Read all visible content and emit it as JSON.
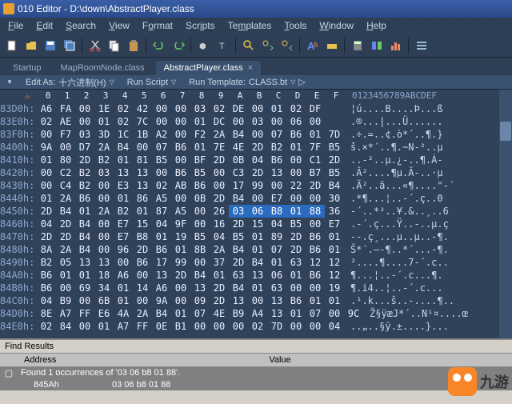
{
  "title": "010 Editor - D:\\down\\AbstractPlayer.class",
  "menu": [
    "File",
    "Edit",
    "Search",
    "View",
    "Format",
    "Scripts",
    "Templates",
    "Tools",
    "Window",
    "Help"
  ],
  "tabs": {
    "startup": "Startup",
    "map": "MapRoomNode.class",
    "active": "AbstractPlayer.class"
  },
  "sub": {
    "star": "☆",
    "editas_lbl": "Edit As:",
    "editas_val": "十六进制(H)",
    "runscript": "Run Script",
    "runtpl_lbl": "Run Template:",
    "runtpl_val": "CLASS.bt"
  },
  "hexcols": [
    "0",
    "1",
    "2",
    "3",
    "4",
    "5",
    "6",
    "7",
    "8",
    "9",
    "A",
    "B",
    "C",
    "D",
    "E",
    "F"
  ],
  "asciicol": "0123456789ABCDEF",
  "rows": [
    {
      "o": "83D0h:",
      "b": [
        "A6",
        "FA",
        "00",
        "1E",
        "02",
        "42",
        "00",
        "00",
        "03",
        "02",
        "DE",
        "00",
        "01",
        "02",
        "DF"
      ],
      "a": "¦ú....B....Þ...ß"
    },
    {
      "o": "83E0h:",
      "b": [
        "02",
        "AE",
        "00",
        "01",
        "02",
        "7C",
        "00",
        "00",
        "01",
        "DC",
        "00",
        "03",
        "00",
        "06",
        "00"
      ],
      "a": ".®...|...Ü......"
    },
    {
      "o": "83F0h:",
      "b": [
        "00",
        "F7",
        "03",
        "3D",
        "1C",
        "1B",
        "A2",
        "00",
        "F2",
        "2A",
        "B4",
        "00",
        "07",
        "B6",
        "01",
        "7D"
      ],
      "a": ".÷.=..¢.ò*´..¶.}"
    },
    {
      "o": "8400h:",
      "b": [
        "9A",
        "00",
        "D7",
        "2A",
        "B4",
        "00",
        "07",
        "B6",
        "01",
        "7E",
        "4E",
        "2D",
        "B2",
        "01",
        "7F",
        "B5"
      ],
      "a": "š.×*´..¶.~N-²..µ"
    },
    {
      "o": "8410h:",
      "b": [
        "01",
        "80",
        "2D",
        "B2",
        "01",
        "81",
        "B5",
        "00",
        "BF",
        "2D",
        "0B",
        "04",
        "B6",
        "00",
        "C1",
        "2D"
      ],
      "a": "..-²..µ.¿-..¶.Á-"
    },
    {
      "o": "8420h:",
      "b": [
        "00",
        "C2",
        "B2",
        "03",
        "13",
        "13",
        "00",
        "B6",
        "B5",
        "00",
        "C3",
        "2D",
        "13",
        "00",
        "B7",
        "B5"
      ],
      "a": ".Â²....¶µ.Ã-..·µ"
    },
    {
      "o": "8430h:",
      "b": [
        "00",
        "C4",
        "B2",
        "00",
        "E3",
        "13",
        "02",
        "AB",
        "B6",
        "00",
        "17",
        "99",
        "00",
        "22",
        "2D",
        "B4"
      ],
      "a": ".Ä²..ã...«¶....\"-´"
    },
    {
      "o": "8440h:",
      "b": [
        "01",
        "2A",
        "B6",
        "00",
        "01",
        "86",
        "A5",
        "00",
        "0B",
        "2D",
        "B4",
        "00",
        "E7",
        "00",
        "00",
        "30"
      ],
      "a": ".*¶...¦..-´.ç..0"
    },
    {
      "o": "8450h:",
      "b": [
        "2D",
        "B4",
        "01",
        "2A",
        "B2",
        "01",
        "87",
        "A5",
        "00",
        "26",
        "03",
        "06",
        "B8",
        "01",
        "88",
        "36"
      ],
      "hl": [
        10,
        11,
        12,
        13,
        14
      ],
      "a": "-´..*²..¥.&..¸..6"
    },
    {
      "o": "8460h:",
      "b": [
        "04",
        "2D",
        "B4",
        "00",
        "E7",
        "15",
        "04",
        "9F",
        "00",
        "16",
        "2D",
        "15",
        "04",
        "B5",
        "00",
        "E7"
      ],
      "a": ".-´.ç...Ÿ..-..µ.ç"
    },
    {
      "o": "8470h:",
      "b": [
        "2D",
        "2D",
        "B4",
        "00",
        "E7",
        "B8",
        "01",
        "19",
        "B5",
        "04",
        "B5",
        "01",
        "89",
        "2D",
        "B6",
        "01"
      ],
      "a": "--.ç¸...µ..µ..-¶."
    },
    {
      "o": "8480h:",
      "b": [
        "8A",
        "2A",
        "B4",
        "00",
        "96",
        "2D",
        "B6",
        "01",
        "8B",
        "2A",
        "B4",
        "01",
        "07",
        "2D",
        "B6",
        "01"
      ],
      "a": "Š*´.–-¶..*´...-¶."
    },
    {
      "o": "8490h:",
      "b": [
        "B2",
        "05",
        "13",
        "13",
        "00",
        "B6",
        "17",
        "99",
        "00",
        "37",
        "2D",
        "B4",
        "01",
        "63",
        "12",
        "12"
      ],
      "a": "²....¶....7-´.c.."
    },
    {
      "o": "84A0h:",
      "b": [
        "B6",
        "01",
        "01",
        "18",
        "A6",
        "00",
        "13",
        "2D",
        "B4",
        "01",
        "63",
        "13",
        "06",
        "01",
        "B6",
        "12"
      ],
      "a": "¶...¦..-´.c...¶."
    },
    {
      "o": "84B0h:",
      "b": [
        "B6",
        "00",
        "69",
        "34",
        "01",
        "14",
        "A6",
        "00",
        "13",
        "2D",
        "B4",
        "01",
        "63",
        "00",
        "00",
        "19"
      ],
      "a": "¶.i4..¦..-´.c..."
    },
    {
      "o": "84C0h:",
      "b": [
        "04",
        "B9",
        "00",
        "6B",
        "01",
        "00",
        "9A",
        "00",
        "09",
        "2D",
        "13",
        "00",
        "13",
        "B6",
        "01",
        "01"
      ],
      "a": ".¹.k...š..-....¶.."
    },
    {
      "o": "84D0h:",
      "b": [
        "8E",
        "A7",
        "FF",
        "E6",
        "4A",
        "2A",
        "B4",
        "01",
        "07",
        "4E",
        "B9",
        "A4",
        "13",
        "01",
        "07",
        "00",
        "9C"
      ],
      "a": "Ž§ÿæJ*´..N¹¤....œ"
    },
    {
      "o": "84E0h:",
      "b": [
        "02",
        "84",
        "00",
        "01",
        "A7",
        "FF",
        "0E",
        "B1",
        "00",
        "00",
        "00",
        "02",
        "7D",
        "00",
        "00",
        "04"
      ],
      "a": "..„..§ÿ.±....}..."
    }
  ],
  "find": {
    "title": "Find Results",
    "addr": "Address",
    "value": "Value",
    "found": "Found 1 occurrences of '03 06 b8 01 88'.",
    "addrv": "845Ah",
    "bytesv": "03 06 b8 01 88"
  },
  "logo": "九游"
}
